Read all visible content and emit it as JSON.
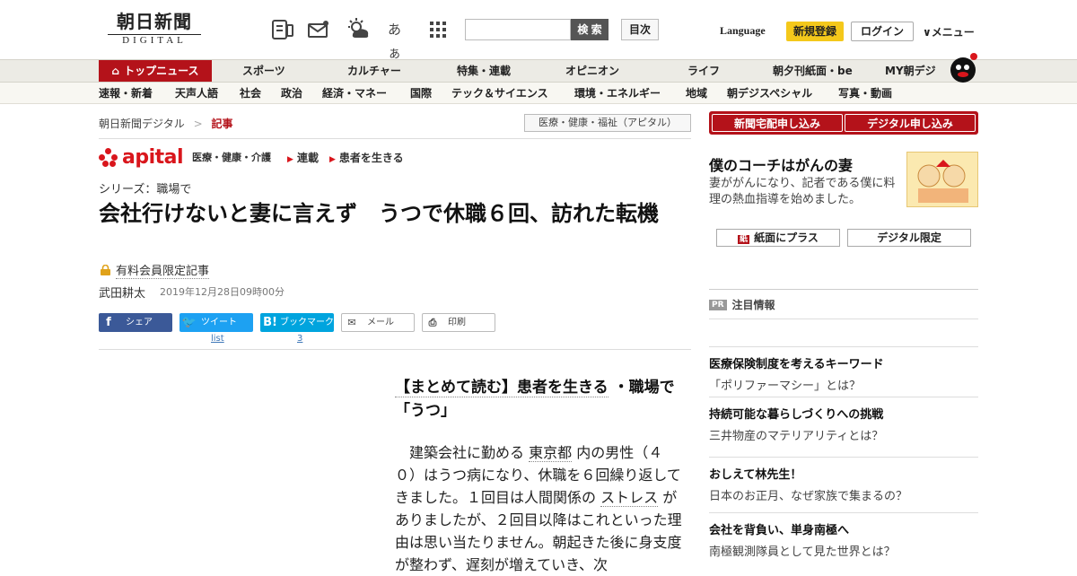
{
  "header": {
    "logo_jp": "朝日新聞",
    "logo_en": "DIGITAL",
    "icons": [
      "digital-newspaper-icon",
      "mail-icon",
      "weather-icon",
      "font-size-icon",
      "apps-grid-icon"
    ],
    "font_size_label": "あぁ",
    "search_button": "検 索",
    "toc_button": "目次",
    "language": "Language",
    "register": "新規登録",
    "login": "ログイン",
    "menu": "メニュー"
  },
  "nav_main": [
    "トップニュース",
    "スポーツ",
    "カルチャー",
    "特集・連載",
    "オピニオン",
    "ライフ",
    "朝夕刊紙面・be",
    "MY朝デジ"
  ],
  "nav_sub": [
    "速報・新着",
    "天声人語",
    "社会",
    "政治",
    "経済・マネー",
    "国際",
    "テック＆サイエンス",
    "環境・エネルギー",
    "地域",
    "朝デジスペシャル",
    "写真・動画"
  ],
  "breadcrumb": {
    "home": "朝日新聞デジタル",
    "sep": ">",
    "current": "記事",
    "tag": "医療・健康・福祉（アピタル）"
  },
  "apital": {
    "logo": "apital",
    "sub": "医療・健康・介護",
    "links": [
      "連載",
      "患者を生きる"
    ]
  },
  "article": {
    "series": "シリーズ：職場で",
    "title": "会社行けないと妻に言えず　うつで休職６回、訪れた転機",
    "paid": "有料会員限定記事",
    "author": "武田耕太",
    "date": "2019年12月28日09時00分",
    "share": {
      "facebook": "シェア",
      "twitter": "ツイート",
      "hatena": "ブックマーク",
      "mail": "メール",
      "print": "印刷",
      "twitter_count": "list",
      "hatena_count": "3"
    },
    "matome_prefix": "【まとめて読む】患者を生きる",
    "matome_suffix": "・職場で「うつ」",
    "body_1": "　建築会社に勤める",
    "body_link1": "東京都",
    "body_2": "内の男性（４０）はうつ病になり、休職を６回繰り返してきました。１回目は人間関係の",
    "body_link2": "ストレス",
    "body_3": "がありましたが、２回目以降はこれといった理由は思い当たりません。朝起きた後に身支度が整わず、遅刻が増えていき、次"
  },
  "sidebar": {
    "subscribe": [
      "新聞宅配申し込み",
      "デジタル申し込み"
    ],
    "promo_title": "僕のコーチはがんの妻",
    "promo_desc": "妻ががんになり、記者である僕に料理の熱血指導を始めました。",
    "plus_button": "紙面にプラス",
    "digital_button": "デジタル限定",
    "pr_tag": "PR",
    "pr_heading": "注目情報",
    "ads": [
      {
        "title": "医療保険制度を考えるキーワード",
        "desc": "「ポリファーマシー」とは？"
      },
      {
        "title": "持続可能な暮らしづくりへの挑戦",
        "desc": "三井物産のマテリアリティとは？"
      },
      {
        "title": "おしえて林先生！",
        "desc": "日本のお正月、なぜ家族で集まるの？"
      },
      {
        "title": "会社を背負い、単身南極へ",
        "desc": "南極観測隊員として見た世界とは？"
      }
    ]
  },
  "colors": {
    "brand_red": "#b4121a",
    "apital_red": "#d9161c",
    "register_yellow": "#f4c81b",
    "facebook": "#3b5998",
    "twitter": "#1da1f2",
    "hatena": "#00a4de"
  }
}
